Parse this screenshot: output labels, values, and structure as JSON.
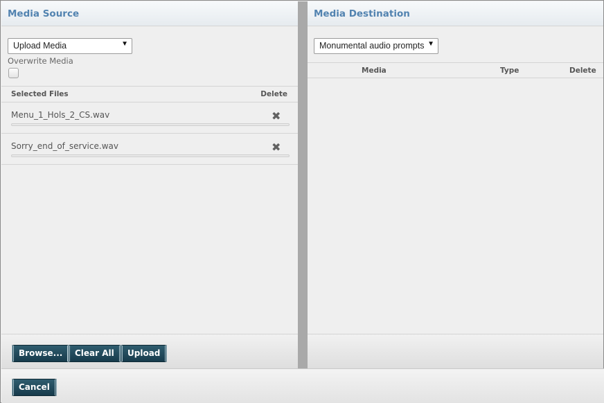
{
  "source": {
    "title": "Media Source",
    "select_value": "Upload Media",
    "overwrite_label": "Overwrite Media",
    "overwrite_checked": false,
    "columns": {
      "files": "Selected Files",
      "delete": "Delete"
    },
    "files": [
      {
        "name": "Menu_1_Hols_2_CS.wav",
        "progress": 0
      },
      {
        "name": "Sorry_end_of_service.wav",
        "progress": 0
      }
    ],
    "buttons": {
      "browse": "Browse...",
      "clear_all": "Clear All",
      "upload": "Upload"
    }
  },
  "destination": {
    "title": "Media Destination",
    "select_value": "Monumental audio prompts",
    "columns": {
      "media": "Media",
      "type": "Type",
      "delete": "Delete"
    }
  },
  "footer": {
    "cancel": "Cancel"
  },
  "icons": {
    "select_arrow": "▼",
    "delete": "✖"
  },
  "colors": {
    "title": "#5283b0",
    "button": "#1f4859",
    "divider": "#a9a9a9"
  }
}
